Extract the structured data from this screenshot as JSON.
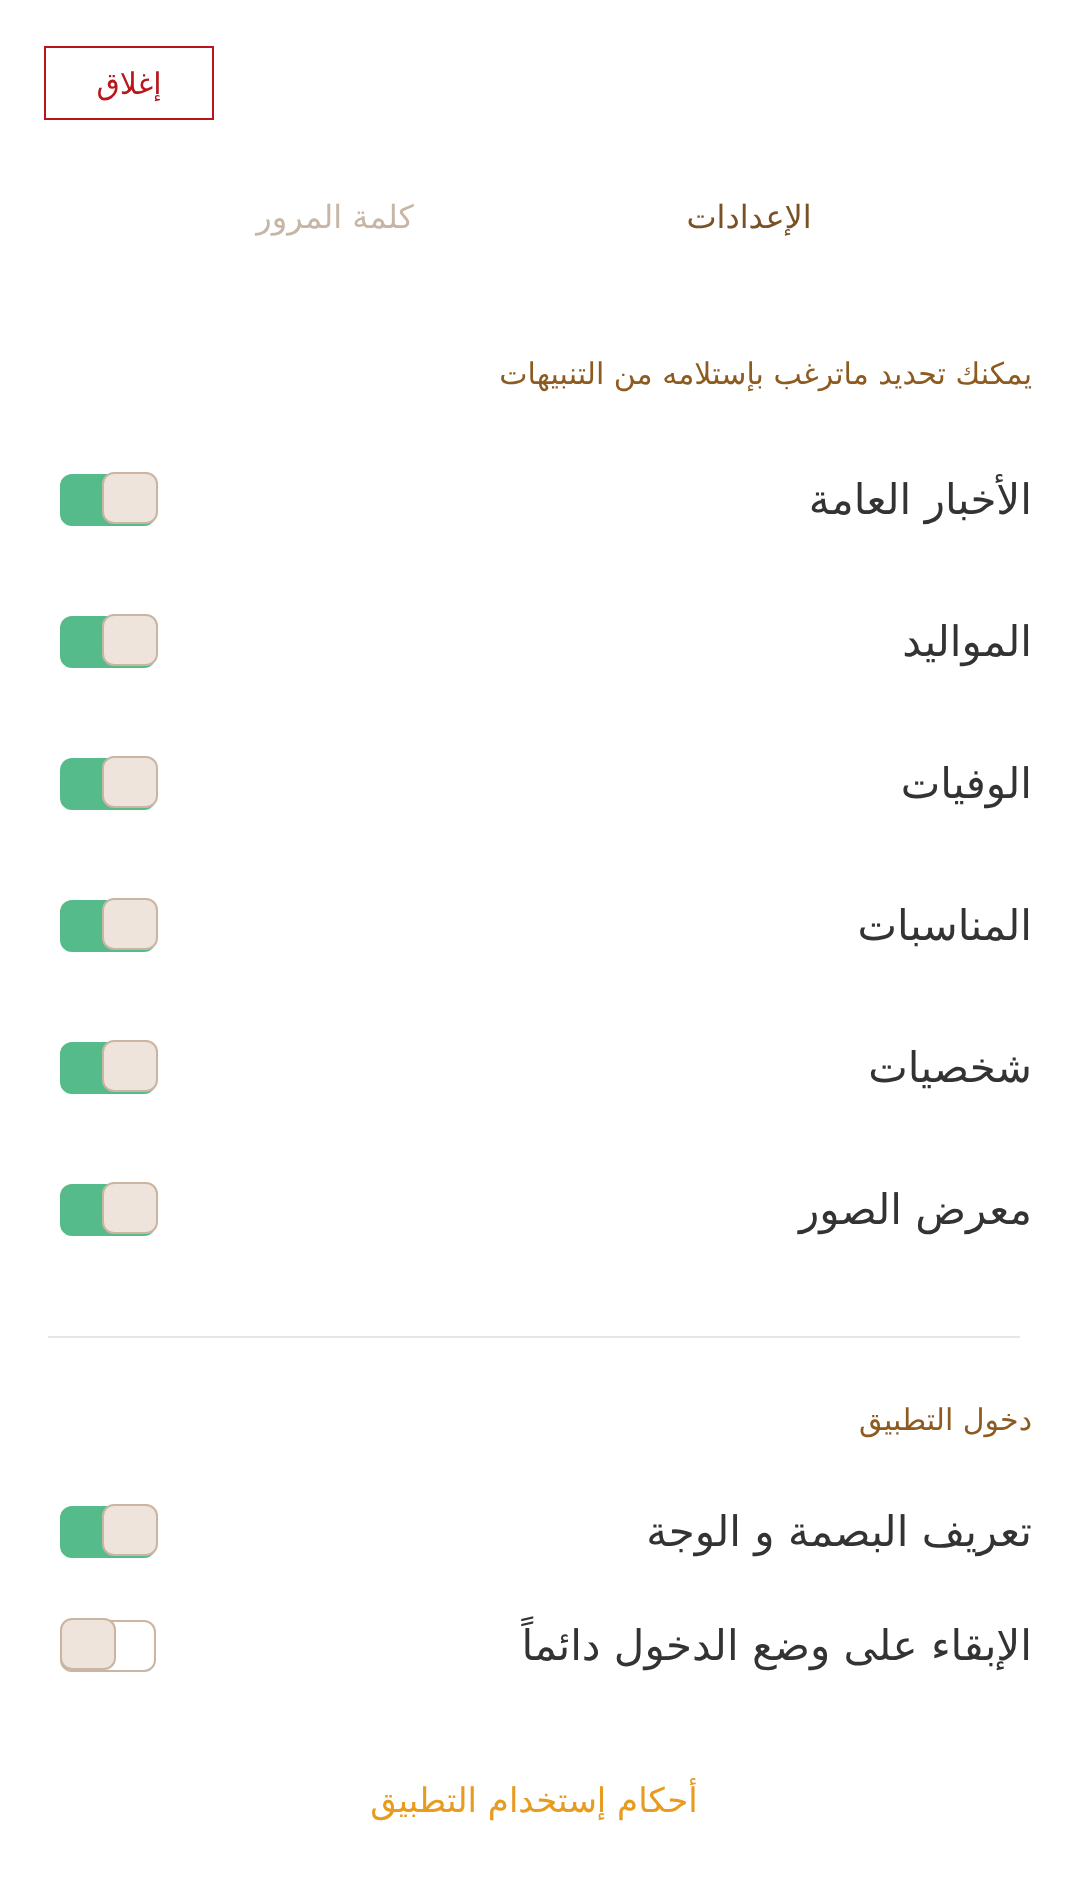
{
  "close_button": "إغلاق",
  "tabs": [
    {
      "label": "الإعدادات",
      "selected": true
    },
    {
      "label": "كلمة المرور",
      "selected": false
    }
  ],
  "notifications": {
    "heading": "يمكنك تحديد ماترغب بإستلامه من التنبيهات",
    "items": [
      {
        "label": "الأخبار العامة",
        "on": true
      },
      {
        "label": "المواليد",
        "on": true
      },
      {
        "label": "الوفيات",
        "on": true
      },
      {
        "label": "المناسبات",
        "on": true
      },
      {
        "label": "شخصيات",
        "on": true
      },
      {
        "label": "معرض الصور",
        "on": true
      }
    ]
  },
  "app_login": {
    "heading": "دخول التطبيق",
    "items": [
      {
        "label": "تعريف البصمة و الوجة",
        "on": true
      },
      {
        "label": "الإبقاء على وضع الدخول دائماً",
        "on": false
      }
    ]
  },
  "terms_link": "أحكام إستخدام التطبيق"
}
